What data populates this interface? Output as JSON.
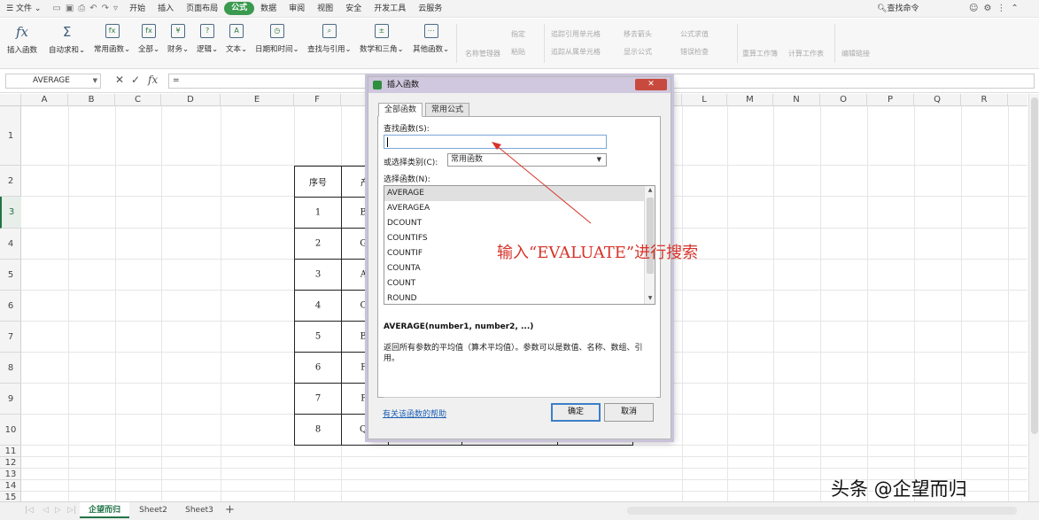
{
  "menubar": {
    "file_label": "文件",
    "tabs": [
      "开始",
      "插入",
      "页面布局",
      "公式",
      "数据",
      "审阅",
      "视图",
      "安全",
      "开发工具",
      "云服务"
    ],
    "active_tab": "公式",
    "search_command": "查找命令"
  },
  "ribbon": {
    "buttons": [
      {
        "label": "插入函数",
        "icon": "fx-icon"
      },
      {
        "label": "自动求和",
        "icon": "sigma-icon"
      },
      {
        "label": "常用函数",
        "icon": "common-function-icon"
      },
      {
        "label": "全部",
        "icon": "all-functions-icon"
      },
      {
        "label": "财务",
        "icon": "finance-icon"
      },
      {
        "label": "逻辑",
        "icon": "logic-icon"
      },
      {
        "label": "文本",
        "icon": "text-icon"
      },
      {
        "label": "日期和时间",
        "icon": "clock-icon"
      },
      {
        "label": "查找与引用",
        "icon": "lookup-icon"
      },
      {
        "label": "数学和三角",
        "icon": "math-icon"
      },
      {
        "label": "其他函数",
        "icon": "more-functions-icon"
      }
    ],
    "disabled_tools": [
      "名称管理器",
      "指定",
      "粘贴",
      "追踪引用单元格",
      "移去箭头",
      "公式求值",
      "追踪从属单元格",
      "显示公式",
      "错误检查",
      "重算工作簿",
      "计算工作表",
      "编辑链接"
    ]
  },
  "formula_bar": {
    "name_box": "AVERAGE",
    "input": "="
  },
  "grid": {
    "columns": [
      "A",
      "B",
      "C",
      "D",
      "E",
      "F",
      "",
      "",
      "",
      "",
      "",
      "L",
      "M",
      "N",
      "O",
      "P",
      "Q",
      "R"
    ],
    "rows": [
      "1",
      "2",
      "3",
      "4",
      "5",
      "6",
      "7",
      "8",
      "9",
      "10",
      "11",
      "12",
      "13",
      "14",
      "15"
    ],
    "selected_row": "3",
    "table": {
      "header": [
        "序号",
        "产"
      ],
      "rows": [
        [
          "1",
          "B-"
        ],
        [
          "2",
          "G-"
        ],
        [
          "3",
          "A-"
        ],
        [
          "4",
          "C-"
        ],
        [
          "5",
          "B-"
        ],
        [
          "6",
          "F-"
        ],
        [
          "7",
          "P-"
        ],
        [
          "8",
          "Q-"
        ]
      ]
    }
  },
  "dialog": {
    "title": "插入函数",
    "tabs": [
      "全部函数",
      "常用公式"
    ],
    "search_label": "查找函数(S):",
    "search_value": "",
    "category_label": "或选择类别(C):",
    "category_value": "常用函数",
    "list_label": "选择函数(N):",
    "functions": [
      "AVERAGE",
      "AVERAGEA",
      "DCOUNT",
      "COUNTIFS",
      "COUNTIF",
      "COUNTA",
      "COUNT",
      "ROUND"
    ],
    "selected_function": "AVERAGE",
    "signature": "AVERAGE(number1, number2, ...)",
    "description": "返回所有参数的平均值（算术平均值）。参数可以是数值、名称、数组、引用。",
    "help_link": "有关该函数的帮助",
    "ok_label": "确定",
    "cancel_label": "取消"
  },
  "annotation": "输入“EVALUATE”进行搜索",
  "sheets": [
    "企望而归",
    "Sheet2",
    "Sheet3"
  ],
  "active_sheet": "企望而归",
  "watermark": "头条 @企望而归",
  "colors": {
    "accent": "#3a9a4f",
    "annotation": "#d7332a",
    "dialog_title": "#cfc8de",
    "close": "#c84a3e"
  }
}
